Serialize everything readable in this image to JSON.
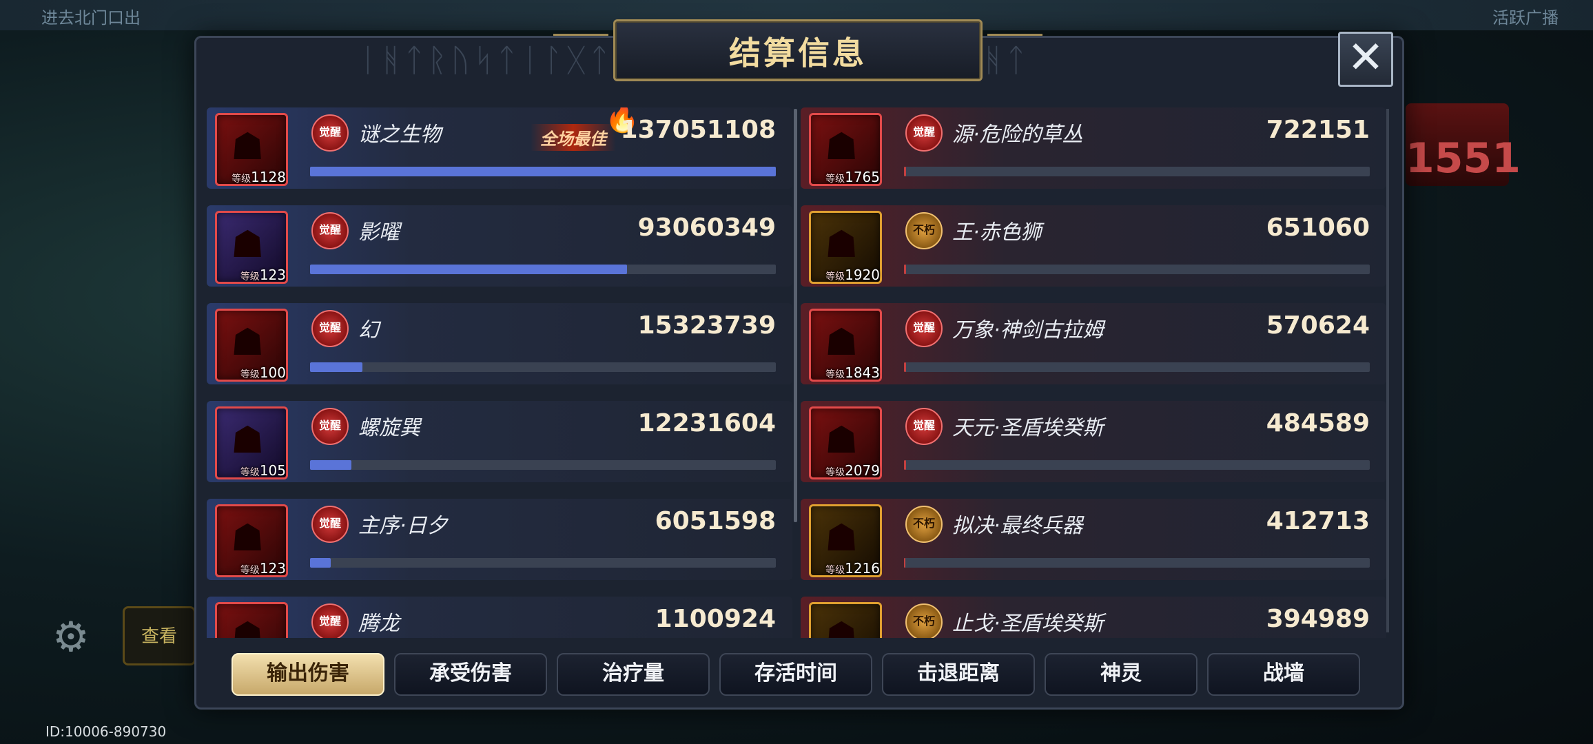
{
  "background": {
    "top_left_text": "进去北门口出",
    "top_right_text": "活跃广播",
    "right_card_number": "1551",
    "left_box_label": "查看",
    "footer_id": "ID:10006-890730"
  },
  "dialog": {
    "title": "结算信息",
    "close_label": "✕",
    "header_deco_text": "ᛁᚻᛏᚱᚢᛋᛏᛁᛚᚷᛏᛁᛋᛁᚻᛏᚱᚢᛋᛏᛁᛚᚷᛏᛁᛋᛁᚻᛏ"
  },
  "best_label": "全场最佳",
  "level_prefix": "等级",
  "left_team": [
    {
      "name": "谜之生物",
      "badge": "觉醒",
      "level": "1128",
      "value": "137051108",
      "ratio": 1.0,
      "best": true,
      "frame": "red"
    },
    {
      "name": "影曜",
      "badge": "觉醒",
      "level": "123",
      "value": "93060349",
      "ratio": 0.68,
      "best": false,
      "frame": "blue"
    },
    {
      "name": "幻",
      "badge": "觉醒",
      "level": "100",
      "value": "15323739",
      "ratio": 0.112,
      "best": false,
      "frame": "red"
    },
    {
      "name": "螺旋巽",
      "badge": "觉醒",
      "level": "105",
      "value": "12231604",
      "ratio": 0.089,
      "best": false,
      "frame": "blue"
    },
    {
      "name": "主序·日夕",
      "badge": "觉醒",
      "level": "123",
      "value": "6051598",
      "ratio": 0.044,
      "best": false,
      "frame": "red"
    },
    {
      "name": "腾龙",
      "badge": "觉醒",
      "level": "",
      "value": "1100924",
      "ratio": 0.008,
      "best": false,
      "frame": "red"
    }
  ],
  "right_team": [
    {
      "name": "源·危险的草丛",
      "badge": "觉醒",
      "level": "1765",
      "value": "722151",
      "ratio": 0.005,
      "frame": "red"
    },
    {
      "name": "王·赤色狮",
      "badge": "不朽",
      "level": "1920",
      "value": "651060",
      "ratio": 0.005,
      "frame": "gold"
    },
    {
      "name": "万象·神剑古拉姆",
      "badge": "觉醒",
      "level": "1843",
      "value": "570624",
      "ratio": 0.004,
      "frame": "red"
    },
    {
      "name": "天元·圣盾埃癸斯",
      "badge": "觉醒",
      "level": "2079",
      "value": "484589",
      "ratio": 0.004,
      "frame": "red"
    },
    {
      "name": "拟决·最终兵器",
      "badge": "不朽",
      "level": "1216",
      "value": "412713",
      "ratio": 0.003,
      "frame": "gold"
    },
    {
      "name": "止戈·圣盾埃癸斯",
      "badge": "不朽",
      "level": "",
      "value": "394989",
      "ratio": 0.003,
      "frame": "gold"
    }
  ],
  "tabs": [
    {
      "label": "输出伤害",
      "active": true
    },
    {
      "label": "承受伤害",
      "active": false
    },
    {
      "label": "治疗量",
      "active": false
    },
    {
      "label": "存活时间",
      "active": false
    },
    {
      "label": "击退距离",
      "active": false
    },
    {
      "label": "神灵",
      "active": false
    },
    {
      "label": "战墙",
      "active": false
    }
  ],
  "colors": {
    "left_bar": "#5a74d8",
    "right_bar": "#c44040",
    "active_tab": "#e8d29c",
    "title_gold": "#f2dca0"
  }
}
